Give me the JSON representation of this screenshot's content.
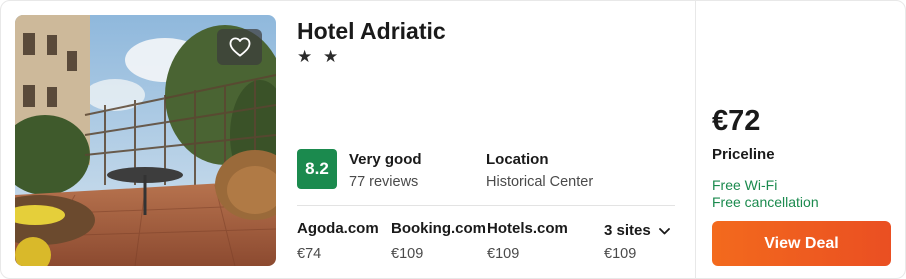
{
  "hotel": {
    "name": "Hotel Adriatic",
    "stars": "★ ★"
  },
  "rating": {
    "score": "8.2",
    "label": "Very good",
    "reviews": "77 reviews"
  },
  "location": {
    "label": "Location",
    "value": "Historical Center"
  },
  "sites": [
    {
      "name": "Agoda.com",
      "price": "€74"
    },
    {
      "name": "Booking.com",
      "price": "€109"
    },
    {
      "name": "Hotels.com",
      "price": "€109"
    }
  ],
  "more_sites": {
    "label": "3 sites",
    "price": "€109"
  },
  "deal": {
    "price": "€72",
    "provider": "Priceline",
    "perks": [
      "Free Wi-Fi",
      "Free cancellation"
    ],
    "button_label": "View Deal"
  },
  "colors": {
    "rating_green": "#1b8a4e",
    "perk_green": "#1b8a4e",
    "cta_orange": "#f36a1d"
  },
  "icons": {
    "favorite": "heart-outline-icon",
    "expand": "chevron-down-icon"
  }
}
